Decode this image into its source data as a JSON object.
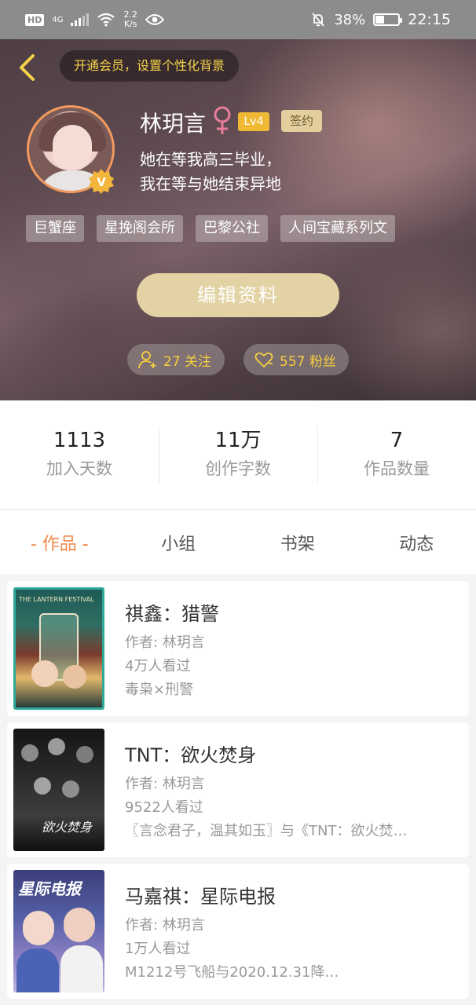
{
  "status_bar": {
    "hd": "HD",
    "network": "4G",
    "speed_value": "2.2",
    "speed_unit": "K/s",
    "battery": "38%",
    "battery_level": 0.38,
    "time": "22:15"
  },
  "header": {
    "vip_prompt": "开通会员，设置个性化背景"
  },
  "profile": {
    "nickname": "林玥言",
    "level": "Lv4",
    "signed": "签约",
    "bio_line1": "她在等我高三毕业，",
    "bio_line2": "我在等与她结束异地",
    "tags": [
      "巨蟹座",
      "星挽阁会所",
      "巴黎公社",
      "人间宝藏系列文"
    ],
    "edit_button": "编辑资料",
    "following": "27 关注",
    "fans": "557 粉丝"
  },
  "stats": [
    {
      "value": "1113",
      "label": "加入天数"
    },
    {
      "value": "11万",
      "label": "创作字数"
    },
    {
      "value": "7",
      "label": "作品数量"
    }
  ],
  "tabs": [
    "- 作品 -",
    "小组",
    "书架",
    "动态"
  ],
  "works": [
    {
      "title": "祺鑫：猎警",
      "author": "作者: 林玥言",
      "views": "4万人看过",
      "desc": "毒枭×刑警",
      "cover_text": "THE LANTERN FESTIVAL"
    },
    {
      "title": "TNT：欲火焚身",
      "author": "作者: 林玥言",
      "views": "9522人看过",
      "desc": "〖言念君子，温其如玉〗与《TNT：欲火焚…",
      "cover_text": "欲火焚身"
    },
    {
      "title": "马嘉祺：星际电报",
      "author": "作者: 林玥言",
      "views": "1万人看过",
      "desc": "M1212号飞船与2020.12.31降…",
      "cover_text": "星际电报"
    }
  ],
  "colors": {
    "accent": "#f08a4b",
    "gold": "#f5d24a",
    "edit_button": "#e3d2a3"
  }
}
